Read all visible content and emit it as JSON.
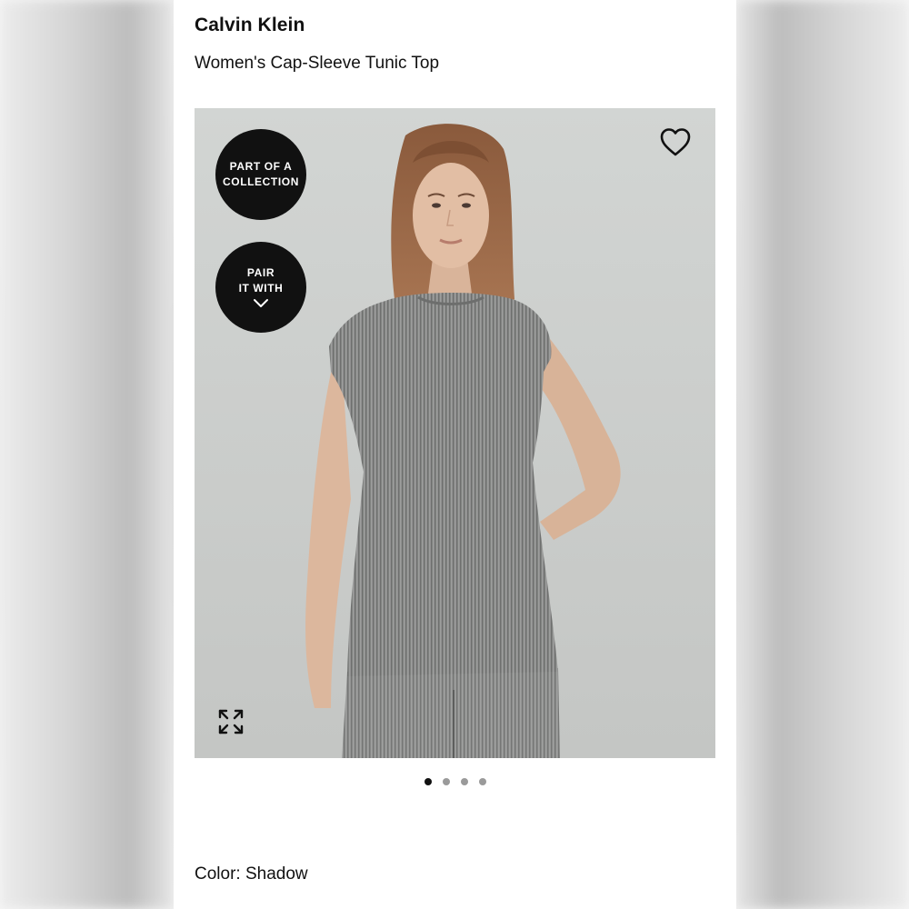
{
  "brand": "Calvin Klein",
  "product_title": "Women's Cap-Sleeve Tunic Top",
  "badges": {
    "collection": [
      "PART OF A",
      "COLLECTION"
    ],
    "pair": [
      "PAIR",
      "IT WITH"
    ]
  },
  "icons": {
    "wishlist": "heart-outline-icon",
    "expand": "expand-arrows-icon",
    "pair_chevron": "chevron-down-icon"
  },
  "carousel": {
    "total": 4,
    "active_index": 0
  },
  "color_label": "Color: Shadow",
  "colors": {
    "badge": "#111111",
    "garment": "#8a8b8a",
    "background": "#c9cbc9",
    "dot_active": "#111111",
    "dot_inactive": "#9a9a9a"
  }
}
